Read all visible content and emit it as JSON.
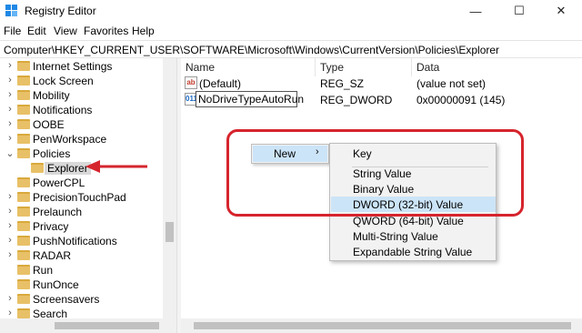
{
  "window": {
    "title": "Registry Editor",
    "controls": {
      "minimize": "—",
      "maximize": "☐",
      "close": "✕"
    }
  },
  "menubar": [
    "File",
    "Edit",
    "View",
    "Favorites",
    "Help"
  ],
  "address": "Computer\\HKEY_CURRENT_USER\\SOFTWARE\\Microsoft\\Windows\\CurrentVersion\\Policies\\Explorer",
  "tree": [
    {
      "label": "Internet Settings",
      "expander": "›"
    },
    {
      "label": "Lock Screen",
      "expander": "›"
    },
    {
      "label": "Mobility",
      "expander": "›"
    },
    {
      "label": "Notifications",
      "expander": "›"
    },
    {
      "label": "OOBE",
      "expander": "›"
    },
    {
      "label": "PenWorkspace",
      "expander": "›"
    },
    {
      "label": "Policies",
      "expander": "⌄"
    },
    {
      "label": "Explorer",
      "expander": ""
    },
    {
      "label": "PowerCPL",
      "expander": ""
    },
    {
      "label": "PrecisionTouchPad",
      "expander": "›"
    },
    {
      "label": "Prelaunch",
      "expander": "›"
    },
    {
      "label": "Privacy",
      "expander": "›"
    },
    {
      "label": "PushNotifications",
      "expander": "›"
    },
    {
      "label": "RADAR",
      "expander": "›"
    },
    {
      "label": "Run",
      "expander": ""
    },
    {
      "label": "RunOnce",
      "expander": ""
    },
    {
      "label": "Screensavers",
      "expander": "›"
    },
    {
      "label": "Search",
      "expander": "›"
    }
  ],
  "list": {
    "headers": {
      "name": "Name",
      "type": "Type",
      "data": "Data"
    },
    "rows": [
      {
        "icon": "ab",
        "name": "(Default)",
        "type": "REG_SZ",
        "data": "(value not set)"
      },
      {
        "icon": "011",
        "name": "NoDriveTypeAutoRun",
        "type": "REG_DWORD",
        "data": "0x00000091 (145)"
      }
    ]
  },
  "context_menu": {
    "new_label": "New",
    "submenu_arrow": "›",
    "items": [
      "Key",
      "String Value",
      "Binary Value",
      "DWORD (32-bit) Value",
      "QWORD (64-bit) Value",
      "Multi-String Value",
      "Expandable String Value"
    ],
    "highlighted": "DWORD (32-bit) Value"
  },
  "colors": {
    "annotation": "#d6242d",
    "highlight": "#cce4f7",
    "folder": "#e8c067"
  }
}
